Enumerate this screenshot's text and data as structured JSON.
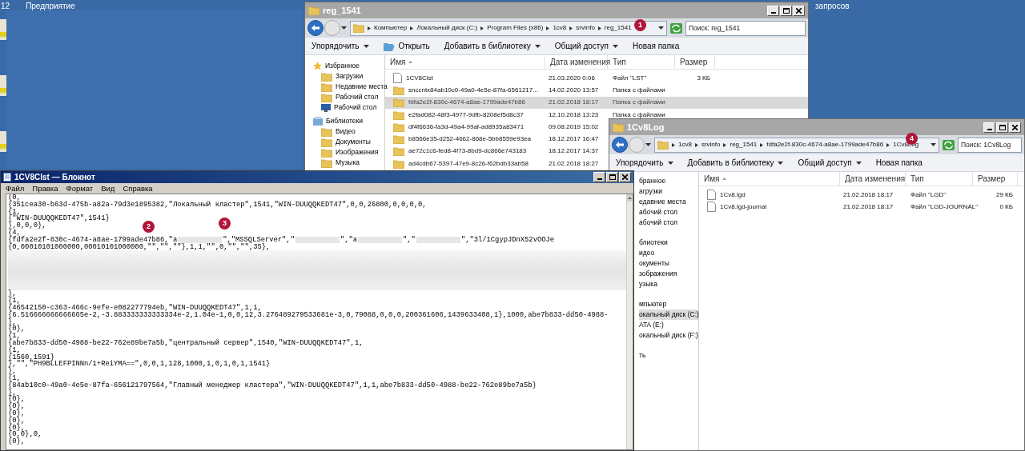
{
  "desktop": {
    "labels": [
      {
        "text": "12"
      },
      {
        "text": "Предприятие"
      },
      {
        "text": "запросов"
      }
    ]
  },
  "explorers": [
    {
      "title": "reg_1541",
      "path": [
        "Компьютер",
        "Локальный диск (C:)",
        "Program Files (x86)",
        "1cv8",
        "srvinfo",
        "reg_1541"
      ],
      "search": {
        "placeholder": "Поиск: reg_1541"
      },
      "toolbar": [
        {
          "label": "Упорядочить",
          "kind": "menu"
        },
        {
          "label": "Открыть",
          "kind": "open"
        },
        {
          "label": "Добавить в библиотеку",
          "kind": "menu"
        },
        {
          "label": "Общий доступ",
          "kind": "menu"
        },
        {
          "label": "Новая папка",
          "kind": "plain"
        }
      ],
      "nav": [
        {
          "items": [
            {
              "label": "Избранное",
              "kind": "star",
              "selected": false
            },
            {
              "label": "Загрузки",
              "kind": "folder",
              "selected": false
            },
            {
              "label": "Недавние места",
              "kind": "folder",
              "selected": false
            },
            {
              "label": "Рабочий стол",
              "kind": "folder",
              "selected": false
            },
            {
              "label": "Рабочий стол",
              "kind": "monitor",
              "selected": false
            }
          ]
        },
        {
          "items": [
            {
              "label": "Библиотеки",
              "kind": "library",
              "selected": false
            },
            {
              "label": "Видео",
              "kind": "folder",
              "selected": false
            },
            {
              "label": "Документы",
              "kind": "folder",
              "selected": false
            },
            {
              "label": "Изображения",
              "kind": "folder",
              "selected": false
            },
            {
              "label": "Музыка",
              "kind": "folder",
              "selected": false
            }
          ]
        }
      ],
      "columns": [
        "Имя",
        "Дата изменения",
        "Тип",
        "Размер"
      ],
      "rows": [
        {
          "name": "1CV8Clst",
          "date": "21.03.2020 0:06",
          "type": "Файл \"LST\"",
          "size": "3 КБ",
          "kind": "file",
          "selected": false
        },
        {
          "name": "snccntx84ab10c0-49a0-4e5e-87fa-6561217...",
          "date": "14.02.2020 13:57",
          "type": "Папка с файлами",
          "kind": "folder",
          "selected": false
        },
        {
          "name": "fdfa2e2f-830c-4674-a8ae-1799ade47b86",
          "date": "21.02.2018 18:17",
          "type": "Папка с файлами",
          "kind": "folder",
          "selected": true
        },
        {
          "name": "e2fad082-48f3-4977-9dfb-8208ef5d8c37",
          "date": "12.10.2018 13:23",
          "type": "Папка с файлами",
          "kind": "folder",
          "selected": false
        },
        {
          "name": "df4f6636-fa3d-49a4-99af-ad8935a83471",
          "date": "09.08.2019 15:02",
          "kind": "folder",
          "selected": false
        },
        {
          "name": "b8566e35-d252-4662-868e-5bb8559e93ea",
          "date": "18.12.2017 16:47",
          "kind": "folder",
          "selected": false
        },
        {
          "name": "ae72c1c6-fed8-4f73-8bd9-dc866e743183",
          "date": "18.12.2017 14:37",
          "kind": "folder",
          "selected": false
        },
        {
          "name": "ad4cdb67-5397-47e9-8c26-f62bdb33ab58",
          "date": "21.02.2018 18:27",
          "kind": "folder",
          "selected": false
        }
      ]
    },
    {
      "title": "1Cv8Log",
      "path": [
        "1cv8",
        "srvinfo",
        "reg_1541",
        "fdfa2e2f-830c-4674-a8ae-1799ade47b86",
        "1Cv8Log"
      ],
      "search": {
        "placeholder": "Поиск: 1Cv8Log"
      },
      "toolbar": [
        {
          "label": "Упорядочить",
          "kind": "menu"
        },
        {
          "label": "Добавить в библиотеку",
          "kind": "menu"
        },
        {
          "label": "Общий доступ",
          "kind": "menu"
        },
        {
          "label": "Новая папка",
          "kind": "plain"
        }
      ],
      "nav": [
        {
          "items": [
            {
              "label": "бранное",
              "kind": "text",
              "selected": false
            },
            {
              "label": "агрузки",
              "kind": "text",
              "selected": false
            },
            {
              "label": "едавние места",
              "kind": "text",
              "selected": false
            },
            {
              "label": "абочий стол",
              "kind": "text",
              "selected": false
            },
            {
              "label": "абочий стол",
              "kind": "text",
              "selected": false
            }
          ]
        },
        {
          "items": [
            {
              "label": "блиотеки",
              "kind": "text",
              "selected": false
            },
            {
              "label": "идео",
              "kind": "text",
              "selected": false
            },
            {
              "label": "окументы",
              "kind": "text",
              "selected": false
            },
            {
              "label": "зображения",
              "kind": "text",
              "selected": false
            },
            {
              "label": "узыка",
              "kind": "text",
              "selected": false
            }
          ]
        },
        {
          "items": [
            {
              "label": "мпьютер",
              "kind": "text",
              "selected": false
            },
            {
              "label": "окальный диск (C:)",
              "kind": "text",
              "selected": true
            },
            {
              "label": "ATA (E:)",
              "kind": "text",
              "selected": false
            },
            {
              "label": "окальный диск (F:)",
              "kind": "text",
              "selected": false
            }
          ]
        },
        {
          "items": [
            {
              "label": "ть",
              "kind": "text",
              "selected": false
            }
          ]
        }
      ],
      "columns": [
        "Имя",
        "Дата изменения",
        "Тип",
        "Размер"
      ],
      "rows": [
        {
          "name": "1Cv8.lgd",
          "date": "21.02.2018 18:17",
          "type": "Файл \"LGD\"",
          "size": "29 КБ",
          "kind": "file",
          "selected": false
        },
        {
          "name": "1Cv8.lgd-journal",
          "date": "21.02.2018 18:17",
          "type": "Файл \"LGD-JOURNAL\"",
          "size": "0 КБ",
          "kind": "file",
          "selected": false
        }
      ]
    }
  ],
  "notepad": {
    "title": "1CV8Clst — Блокнот",
    "menu": [
      "Файл",
      "Правка",
      "Формат",
      "Вид",
      "Справка"
    ],
    "lines": [
      {
        "kind": "text",
        "text": "{0,"
      },
      {
        "kind": "text",
        "text": "{351cea30-b63d-475b-a82a-79d3e1895382,\"Локальный кластер\",1541,\"WIN-DUUQQKEDT47\",0,0,26800,0,0,0,0,"
      },
      {
        "kind": "text",
        "text": "{1,"
      },
      {
        "kind": "text",
        "text": "{\"WIN-DUUQQKEDT47\",1541}"
      },
      {
        "kind": "text",
        "text": "},0,0,0},"
      },
      {
        "kind": "text",
        "text": "{4,"
      },
      {
        "kind": "mixed",
        "parts": [
          {
            "kind": "text",
            "text": "{fdfa2e2f-830c-4674-a8ae-1799ade47b86,\"a"
          },
          {
            "kind": "redacted"
          },
          {
            "kind": "text",
            "text": "\",\"MSSQLServer\",\""
          },
          {
            "kind": "redacted"
          },
          {
            "kind": "text",
            "text": "\",\"a"
          },
          {
            "kind": "redacted"
          },
          {
            "kind": "text",
            "text": "\",\""
          },
          {
            "kind": "redacted"
          },
          {
            "kind": "text",
            "text": "\",\"3l/1CgypJDnX52vOOJe"
          }
        ]
      },
      {
        "kind": "text",
        "text": "{0,00010101000000,00010101000000,\"\",\"\",\"\"},1,1,\"\",0,\"\",\"\",35},"
      },
      {
        "kind": "blurred"
      },
      {
        "kind": "text",
        "text": "},"
      },
      {
        "kind": "text",
        "text": "{1,"
      },
      {
        "kind": "text",
        "text": "{46542150-c363-466c-9efe-e082277794eb,\"WIN-DUUQQKEDT47\",1,1,"
      },
      {
        "kind": "text",
        "text": "{6.516666666666665e-2,-3.883333333333334e-2,1.04e-1,0,0,12,3.276489279533681e-3,0,79088,0,0,0,200361606,1439633408,1},1000,abe7b833-dd50-4988-"
      },
      {
        "kind": "text",
        "text": "},"
      },
      {
        "kind": "text",
        "text": "{0},"
      },
      {
        "kind": "text",
        "text": "{1,"
      },
      {
        "kind": "text",
        "text": "{abe7b833-dd50-4988-be22-762e89be7a5b,\"центральный сервер\",1540,\"WIN-DUUQQKEDT47\",1,"
      },
      {
        "kind": "text",
        "text": "{1,"
      },
      {
        "kind": "text",
        "text": "{1560,1591}"
      },
      {
        "kind": "text",
        "text": "},\"\",\"PH9BLLEFPINNn/1+ReiYMA==\",0,0,1,128,1000,1,0,1,0,1,1541}"
      },
      {
        "kind": "text",
        "text": "},"
      },
      {
        "kind": "text",
        "text": "{1,"
      },
      {
        "kind": "text",
        "text": "{84ab10c0-49a0-4e5e-87fa-656121797564,\"Главный менеджер кластера\",\"WIN-DUUQQKEDT47\",1,1,abe7b833-dd50-4988-be22-762e89be7a5b}"
      },
      {
        "kind": "text",
        "text": "},"
      },
      {
        "kind": "text",
        "text": "{0},"
      },
      {
        "kind": "text",
        "text": "{0},"
      },
      {
        "kind": "text",
        "text": "{0},"
      },
      {
        "kind": "text",
        "text": "{0},"
      },
      {
        "kind": "text",
        "text": "{0},"
      },
      {
        "kind": "text",
        "text": "{0,0},0,"
      },
      {
        "kind": "text",
        "text": "{0},"
      }
    ]
  },
  "badges": [
    "1",
    "2",
    "3",
    "4"
  ]
}
